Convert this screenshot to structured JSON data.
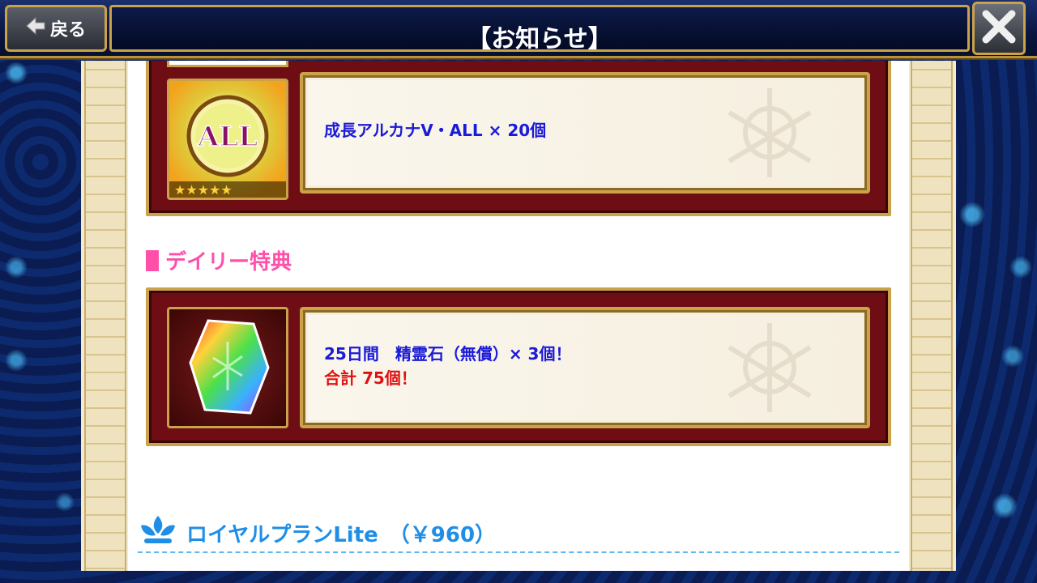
{
  "header": {
    "back_label": "戻る",
    "title": "【お知らせ】"
  },
  "rewards": {
    "growth_item": {
      "text": "成長アルカナV・ALL × 20個",
      "icon_label": "ALL",
      "stars": "★★★★★"
    },
    "daily_heading": "デイリー特典",
    "daily_item": {
      "line1": "25日間　精霊石（無償）× 3個！",
      "line2": "合計 75個！"
    }
  },
  "plan": {
    "title": "ロイヤルプランLite　（￥960）"
  },
  "colors": {
    "accent_gold": "#c9a24a",
    "frame_red": "#6e0e14",
    "text_blue": "#1a1ad8",
    "text_red": "#e01010",
    "heading_pink": "#ff4fa8",
    "plan_blue": "#1f8ee6"
  },
  "icons": [
    "back-arrow-icon",
    "close-icon",
    "all-arcana-icon",
    "spirit-stone-icon",
    "fleur-icon"
  ]
}
